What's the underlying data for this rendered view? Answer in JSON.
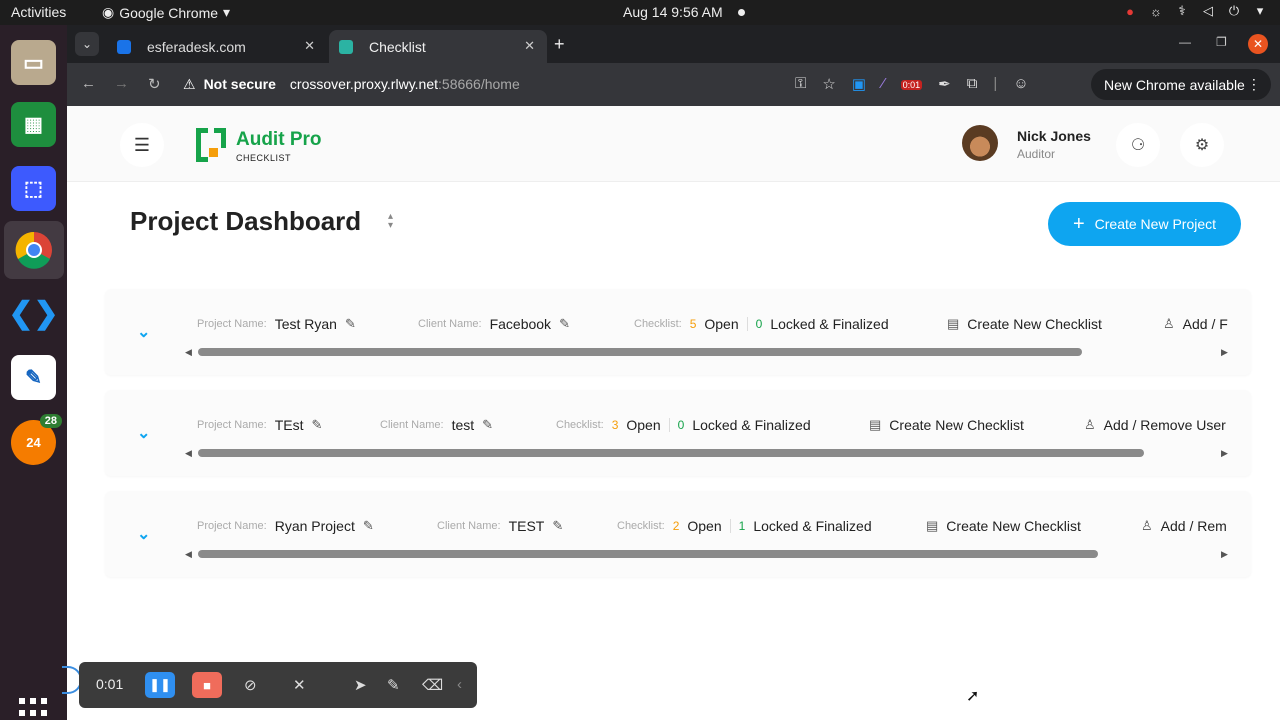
{
  "system_bar": {
    "activities": "Activities",
    "app_name": "Google Chrome",
    "clock": "Aug 14  9:56 AM"
  },
  "dock": {
    "items": [
      "files-icon",
      "spreadsheet-icon",
      "screenshot-icon",
      "chrome-icon",
      "vscode-icon",
      "text-editor-icon",
      "chat-icon"
    ],
    "chat_badge": "28",
    "chat_label": "24"
  },
  "browser": {
    "tabs": [
      {
        "title": "esferadesk.com",
        "fav_color": "#1a73e8",
        "active": false
      },
      {
        "title": "Checklist",
        "fav_color": "#2bb3a3",
        "active": true
      }
    ],
    "security_label": "Not secure",
    "url_host": "crossover.proxy.rlwy.net",
    "url_rest": ":58666/home",
    "update_label": "New Chrome available",
    "rec_badge": "0:01"
  },
  "app": {
    "brand": "Audit Pro",
    "brand_sub": "CHECKLIST",
    "user": {
      "name": "Nick Jones",
      "role": "Auditor"
    },
    "page_title": "Project Dashboard",
    "create_project_label": "Create New Project",
    "accent": "#0ea5f0",
    "brand_color": "#16a34a"
  },
  "labels": {
    "project_name": "Project Name:",
    "client_name": "Client Name:",
    "checklist": "Checklist:",
    "open": "Open",
    "locked": "Locked & Finalized",
    "create_checklist": "Create New Checklist"
  },
  "projects": [
    {
      "name": "Test Ryan",
      "client": "Facebook",
      "open": "5",
      "locked": "0",
      "users_label": "Add / F",
      "scroll_fraction": 0.87
    },
    {
      "name": "TEst",
      "client": "test",
      "open": "3",
      "locked": "0",
      "users_label": "Add / Remove User",
      "scroll_fraction": 0.92
    },
    {
      "name": "Ryan Project",
      "client": "TEST",
      "open": "2",
      "locked": "1",
      "users_label": "Add / Rem",
      "scroll_fraction": 0.88
    }
  ],
  "recorder": {
    "time": "0:01"
  }
}
